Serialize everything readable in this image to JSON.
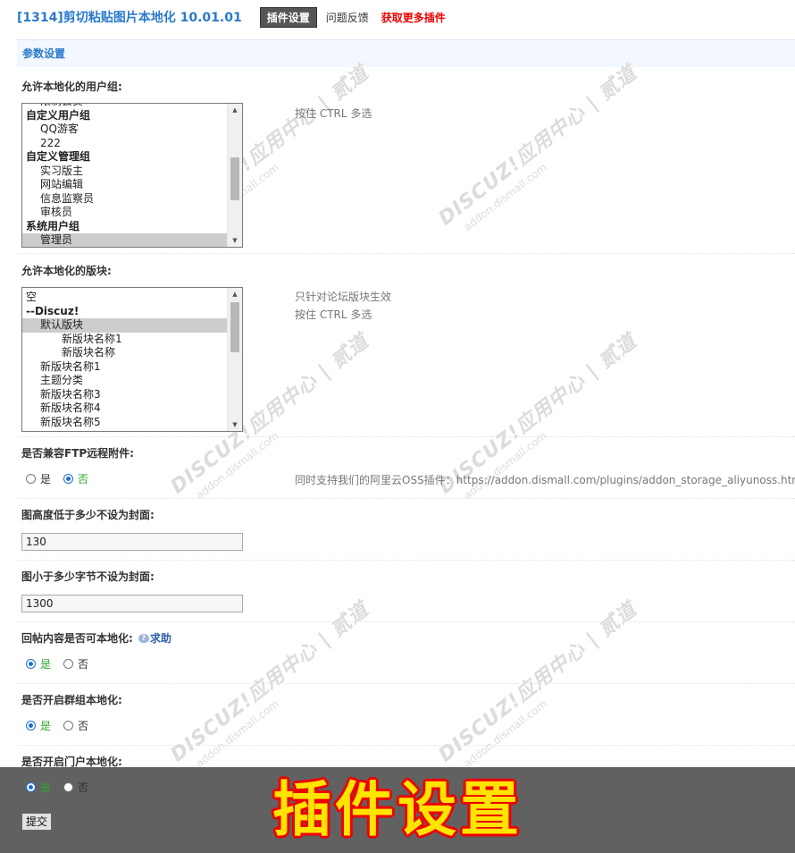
{
  "header": {
    "plugin_title": "[1314]剪切粘贴图片本地化 10.01.01",
    "tab_settings": "插件设置",
    "tab_feedback": "问题反馈",
    "link_more": "获取更多插件"
  },
  "section_title": "参数设置",
  "watermark": {
    "brand": "DISCUZ!应用中心 | 贰道",
    "url": "addon.dismall.com"
  },
  "user_groups": {
    "label": "允许本地化的用户组:",
    "tip": "按住 CTRL 多选",
    "options": [
      {
        "text": "限制会员",
        "level": 1,
        "group": false,
        "selected": false
      },
      {
        "text": "自定义用户组",
        "level": 0,
        "group": true,
        "selected": false
      },
      {
        "text": "QQ游客",
        "level": 1,
        "group": false,
        "selected": false
      },
      {
        "text": "222",
        "level": 1,
        "group": false,
        "selected": false
      },
      {
        "text": "自定义管理组",
        "level": 0,
        "group": true,
        "selected": false
      },
      {
        "text": "实习版主",
        "level": 1,
        "group": false,
        "selected": false
      },
      {
        "text": "网站编辑",
        "level": 1,
        "group": false,
        "selected": false
      },
      {
        "text": "信息监察员",
        "level": 1,
        "group": false,
        "selected": false
      },
      {
        "text": "审核员",
        "level": 1,
        "group": false,
        "selected": false
      },
      {
        "text": "系统用户组",
        "level": 0,
        "group": true,
        "selected": false
      },
      {
        "text": "管理员",
        "level": 1,
        "group": false,
        "selected": true
      }
    ]
  },
  "forums": {
    "label": "允许本地化的版块:",
    "tip1": "只针对论坛版块生效",
    "tip2": "按住 CTRL 多选",
    "options": [
      {
        "text": "空",
        "level": 0,
        "group": false,
        "selected": false
      },
      {
        "text": "--Discuz!",
        "level": 0,
        "group": true,
        "selected": false
      },
      {
        "text": "默认版块",
        "level": 1,
        "group": false,
        "selected": true
      },
      {
        "text": "新版块名称1",
        "level": 2,
        "group": false,
        "selected": false
      },
      {
        "text": "新版块名称",
        "level": 2,
        "group": false,
        "selected": false
      },
      {
        "text": "新版块名称1",
        "level": 1,
        "group": false,
        "selected": false
      },
      {
        "text": "主题分类",
        "level": 1,
        "group": false,
        "selected": false
      },
      {
        "text": "新版块名称3",
        "level": 1,
        "group": false,
        "selected": false
      },
      {
        "text": "新版块名称4",
        "level": 1,
        "group": false,
        "selected": false
      },
      {
        "text": "新版块名称5",
        "level": 1,
        "group": false,
        "selected": false
      }
    ]
  },
  "ftp": {
    "label": "是否兼容FTP远程附件:",
    "yes": "是",
    "no": "否",
    "value": "no",
    "tip": "同时支持我们的阿里云OSS插件：https://addon.dismall.com/plugins/addon_storage_aliyunoss.htm"
  },
  "min_height": {
    "label": "图高度低于多少不设为封面:",
    "value": "130"
  },
  "min_bytes": {
    "label": "图小于多少字节不设为封面:",
    "value": "1300"
  },
  "reply_local": {
    "label": "回帖内容是否可本地化:",
    "help": "求助",
    "yes": "是",
    "no": "否",
    "value": "yes"
  },
  "group_local": {
    "label": "是否开启群组本地化:",
    "yes": "是",
    "no": "否",
    "value": "yes"
  },
  "portal_local": {
    "label": "是否开启门户本地化:",
    "yes": "是",
    "no": "否",
    "value": "yes"
  },
  "submit_label": "提交",
  "banner_text": "插件设置",
  "colors": {
    "accent": "#2b7acd",
    "active_radio": "#1e6fd0",
    "yes_green": "#2fa52f",
    "banner_yellow": "#ffe400",
    "banner_red": "#e00000"
  }
}
